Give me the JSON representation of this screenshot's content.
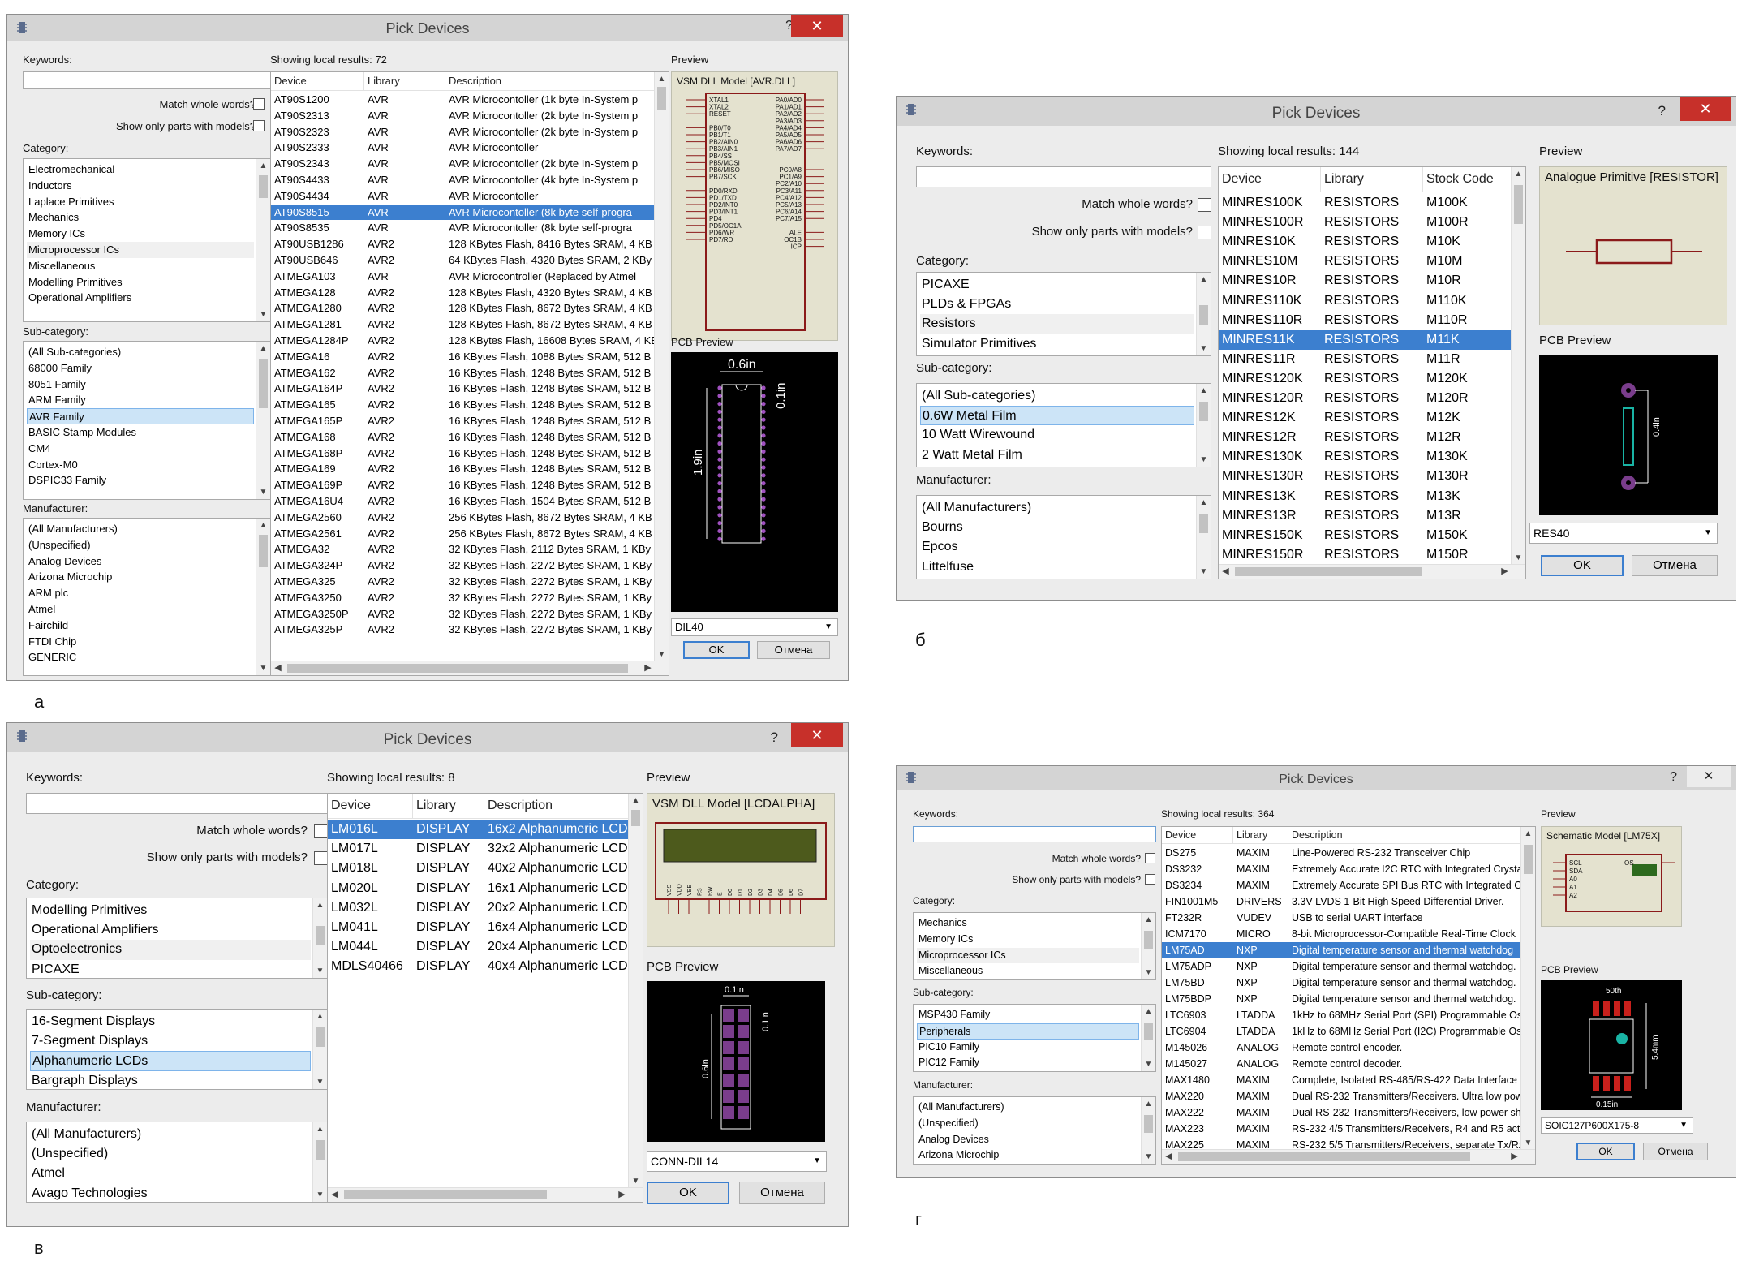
{
  "captions": [
    "а",
    "б",
    "в",
    "г"
  ],
  "common": {
    "title": "Pick Devices",
    "help": "?",
    "close": "✕",
    "keywords_label": "Keywords:",
    "match_whole": "Match whole words?",
    "show_only": "Show only parts with models?",
    "category_label": "Category:",
    "subcategory_label": "Sub-category:",
    "manufacturer_label": "Manufacturer:",
    "preview_label": "Preview",
    "pcb_preview_label": "PCB Preview",
    "ok": "OK",
    "cancel": "Отмена"
  },
  "dialog_a": {
    "results": "Showing local results: 72",
    "preview_title": "VSM DLL Model [AVR.DLL]",
    "footprint": "DIL40",
    "categories": [
      "Electromechanical",
      "Inductors",
      "Laplace Primitives",
      "Mechanics",
      "Memory ICs",
      "Microprocessor ICs",
      "Miscellaneous",
      "Modelling Primitives",
      "Operational Amplifiers"
    ],
    "subcategories": [
      "(All Sub-categories)",
      "68000 Family",
      "8051 Family",
      "ARM Family",
      "AVR Family",
      "BASIC Stamp Modules",
      "CM4",
      "Cortex-M0",
      "DSPIC33 Family"
    ],
    "manufacturers": [
      "(All Manufacturers)",
      "(Unspecified)",
      "Analog Devices",
      "Arizona Microchip",
      "ARM plc",
      "Atmel",
      "Fairchild",
      "FTDI Chip",
      "GENERIC"
    ],
    "columns": [
      "Device",
      "Library",
      "Description"
    ],
    "rows": [
      [
        "AT90S1200",
        "AVR",
        "AVR Microcontoller (1k byte In-System p"
      ],
      [
        "AT90S2313",
        "AVR",
        "AVR Microcontoller (2k byte In-System p"
      ],
      [
        "AT90S2323",
        "AVR",
        "AVR Microcontoller (2k byte In-System p"
      ],
      [
        "AT90S2333",
        "AVR",
        "AVR Microcontoller"
      ],
      [
        "AT90S2343",
        "AVR",
        "AVR Microcontoller (2k byte In-System p"
      ],
      [
        "AT90S4433",
        "AVR",
        "AVR Microcontoller (4k byte In-System p"
      ],
      [
        "AT90S4434",
        "AVR",
        "AVR Microcontoller"
      ],
      [
        "AT90S8515",
        "AVR",
        "AVR Microcontoller (8k byte self-progra"
      ],
      [
        "AT90S8535",
        "AVR",
        "AVR Microcontoller (8k byte self-progra"
      ],
      [
        "AT90USB1286",
        "AVR2",
        "128 KBytes Flash, 8416 Bytes SRAM, 4 KB"
      ],
      [
        "AT90USB646",
        "AVR2",
        "64 KBytes Flash, 4320 Bytes SRAM, 2 KBy"
      ],
      [
        "ATMEGA103",
        "AVR",
        "AVR Microcontroller (Replaced by Atmel"
      ],
      [
        "ATMEGA128",
        "AVR2",
        "128 KBytes Flash, 4320 Bytes SRAM, 4 KB"
      ],
      [
        "ATMEGA1280",
        "AVR2",
        "128 KBytes Flash, 8672 Bytes SRAM, 4 KB"
      ],
      [
        "ATMEGA1281",
        "AVR2",
        "128 KBytes Flash, 8672 Bytes SRAM, 4 KB"
      ],
      [
        "ATMEGA1284P",
        "AVR2",
        "128 KBytes Flash, 16608 Bytes SRAM, 4 KB"
      ],
      [
        "ATMEGA16",
        "AVR2",
        "16 KBytes Flash, 1088 Bytes SRAM, 512 B"
      ],
      [
        "ATMEGA162",
        "AVR2",
        "16 KBytes Flash, 1248 Bytes SRAM, 512 B"
      ],
      [
        "ATMEGA164P",
        "AVR2",
        "16 KBytes Flash, 1248 Bytes SRAM, 512 B"
      ],
      [
        "ATMEGA165",
        "AVR2",
        "16 KBytes Flash, 1248 Bytes SRAM, 512 B"
      ],
      [
        "ATMEGA165P",
        "AVR2",
        "16 KBytes Flash, 1248 Bytes SRAM, 512 B"
      ],
      [
        "ATMEGA168",
        "AVR2",
        "16 KBytes Flash, 1248 Bytes SRAM, 512 B"
      ],
      [
        "ATMEGA168P",
        "AVR2",
        "16 KBytes Flash, 1248 Bytes SRAM, 512 B"
      ],
      [
        "ATMEGA169",
        "AVR2",
        "16 KBytes Flash, 1248 Bytes SRAM, 512 B"
      ],
      [
        "ATMEGA169P",
        "AVR2",
        "16 KBytes Flash, 1248 Bytes SRAM, 512 B"
      ],
      [
        "ATMEGA16U4",
        "AVR2",
        "16 KBytes Flash, 1504 Bytes SRAM, 512 B"
      ],
      [
        "ATMEGA2560",
        "AVR2",
        "256 KBytes Flash, 8672 Bytes SRAM, 4 KB"
      ],
      [
        "ATMEGA2561",
        "AVR2",
        "256 KBytes Flash, 8672 Bytes SRAM, 4 KB"
      ],
      [
        "ATMEGA32",
        "AVR2",
        "32 KBytes Flash, 2112 Bytes SRAM, 1 KBy"
      ],
      [
        "ATMEGA324P",
        "AVR2",
        "32 KBytes Flash, 2272 Bytes SRAM, 1 KBy"
      ],
      [
        "ATMEGA325",
        "AVR2",
        "32 KBytes Flash, 2272 Bytes SRAM, 1 KBy"
      ],
      [
        "ATMEGA3250",
        "AVR2",
        "32 KBytes Flash, 2272 Bytes SRAM, 1 KBy"
      ],
      [
        "ATMEGA3250P",
        "AVR2",
        "32 KBytes Flash, 2272 Bytes SRAM, 1 KBy"
      ],
      [
        "ATMEGA325P",
        "AVR2",
        "32 KBytes Flash, 2272 Bytes SRAM, 1 KBy"
      ]
    ],
    "pin_left": [
      "XTAL1",
      "XTAL2",
      "RESET",
      "",
      "PB0/T0",
      "PB1/T1",
      "PB2/AIN0",
      "PB3/AIN1",
      "PB4/SS",
      "PB5/MOSI",
      "PB6/MISO",
      "PB7/SCK",
      "",
      "PD0/RXD",
      "PD1/TXD",
      "PD2/INT0",
      "PD3/INT1",
      "PD4",
      "PD5/OC1A",
      "PD6/WR",
      "PD7/RD"
    ],
    "pin_right": [
      "PA0/AD0",
      "PA1/AD1",
      "PA2/AD2",
      "PA3/AD3",
      "PA4/AD4",
      "PA5/AD5",
      "PA6/AD6",
      "PA7/AD7",
      "",
      "",
      "PC0/A8",
      "PC1/A9",
      "PC2/A10",
      "PC3/A11",
      "PC4/A12",
      "PC5/A13",
      "PC6/A14",
      "PC7/A15",
      "",
      "ALE",
      "OC1B",
      "ICP"
    ],
    "pcb_width": "0.6in",
    "pcb_pitch": "0.1in",
    "pcb_height": "1.9in"
  },
  "dialog_b": {
    "results": "Showing local results: 144",
    "preview_title": "Analogue Primitive [RESISTOR]",
    "footprint": "RES40",
    "categories": [
      "PICAXE",
      "PLDs & FPGAs",
      "Resistors",
      "Simulator Primitives"
    ],
    "subcategories": [
      "(All Sub-categories)",
      "0.6W Metal Film",
      "10 Watt Wirewound",
      "2 Watt Metal Film"
    ],
    "manufacturers": [
      "(All Manufacturers)",
      "Bourns",
      "Epcos",
      "Littelfuse"
    ],
    "columns": [
      "Device",
      "Library",
      "Stock Code"
    ],
    "rows": [
      [
        "MINRES100K",
        "RESISTORS",
        "M100K"
      ],
      [
        "MINRES100R",
        "RESISTORS",
        "M100R"
      ],
      [
        "MINRES10K",
        "RESISTORS",
        "M10K"
      ],
      [
        "MINRES10M",
        "RESISTORS",
        "M10M"
      ],
      [
        "MINRES10R",
        "RESISTORS",
        "M10R"
      ],
      [
        "MINRES110K",
        "RESISTORS",
        "M110K"
      ],
      [
        "MINRES110R",
        "RESISTORS",
        "M110R"
      ],
      [
        "MINRES11K",
        "RESISTORS",
        "M11K"
      ],
      [
        "MINRES11R",
        "RESISTORS",
        "M11R"
      ],
      [
        "MINRES120K",
        "RESISTORS",
        "M120K"
      ],
      [
        "MINRES120R",
        "RESISTORS",
        "M120R"
      ],
      [
        "MINRES12K",
        "RESISTORS",
        "M12K"
      ],
      [
        "MINRES12R",
        "RESISTORS",
        "M12R"
      ],
      [
        "MINRES130K",
        "RESISTORS",
        "M130K"
      ],
      [
        "MINRES130R",
        "RESISTORS",
        "M130R"
      ],
      [
        "MINRES13K",
        "RESISTORS",
        "M13K"
      ],
      [
        "MINRES13R",
        "RESISTORS",
        "M13R"
      ],
      [
        "MINRES150K",
        "RESISTORS",
        "M150K"
      ],
      [
        "MINRES150R",
        "RESISTORS",
        "M150R"
      ]
    ],
    "pcb_len": "0.4in"
  },
  "dialog_v": {
    "results": "Showing local results: 8",
    "preview_title": "VSM DLL Model [LCDALPHA]",
    "footprint": "CONN-DIL14",
    "categories": [
      "Modelling Primitives",
      "Operational Amplifiers",
      "Optoelectronics",
      "PICAXE"
    ],
    "subcategories": [
      "16-Segment Displays",
      "7-Segment Displays",
      "Alphanumeric LCDs",
      "Bargraph Displays"
    ],
    "manufacturers": [
      "(All Manufacturers)",
      "(Unspecified)",
      "Atmel",
      "Avago Technologies"
    ],
    "columns": [
      "Device",
      "Library",
      "Description"
    ],
    "rows": [
      [
        "LM016L",
        "DISPLAY",
        "16x2 Alphanumeric LCD"
      ],
      [
        "LM017L",
        "DISPLAY",
        "32x2 Alphanumeric LCD"
      ],
      [
        "LM018L",
        "DISPLAY",
        "40x2 Alphanumeric LCD"
      ],
      [
        "LM020L",
        "DISPLAY",
        "16x1 Alphanumeric LCD"
      ],
      [
        "LM032L",
        "DISPLAY",
        "20x2 Alphanumeric LCD"
      ],
      [
        "LM041L",
        "DISPLAY",
        "16x4 Alphanumeric LCD"
      ],
      [
        "LM044L",
        "DISPLAY",
        "20x4 Alphanumeric LCD"
      ],
      [
        "MDLS40466",
        "DISPLAY",
        "40x4 Alphanumeric LCD I"
      ]
    ],
    "lcd_pins": [
      "VSS",
      "VDD",
      "VEE",
      "RS",
      "RW",
      "E",
      "D0",
      "D1",
      "D2",
      "D3",
      "D4",
      "D5",
      "D6",
      "D7"
    ],
    "pcb_pitch_h": "0.1in",
    "pcb_pitch_v": "0.1in",
    "pcb_height": "0.6in"
  },
  "dialog_g": {
    "results": "Showing local results: 364",
    "preview_title": "Schematic Model [LM75X]",
    "footprint": "SOIC127P600X175-8",
    "categories": [
      "Mechanics",
      "Memory ICs",
      "Microprocessor ICs",
      "Miscellaneous"
    ],
    "subcategories": [
      "MSP430 Family",
      "Peripherals",
      "PIC10 Family",
      "PIC12 Family"
    ],
    "manufacturers": [
      "(All Manufacturers)",
      "(Unspecified)",
      "Analog Devices",
      "Arizona Microchip"
    ],
    "columns": [
      "Device",
      "Library",
      "Description"
    ],
    "rows": [
      [
        "DS275",
        "MAXIM",
        "Line-Powered RS-232 Transceiver Chip"
      ],
      [
        "DS3232",
        "MAXIM",
        "Extremely Accurate I2C RTC with Integrated Crysta"
      ],
      [
        "DS3234",
        "MAXIM",
        "Extremely Accurate SPI Bus RTC with Integrated Cr"
      ],
      [
        "FIN1001M5",
        "DRIVERS",
        "3.3V LVDS 1-Bit High Speed Differential Driver."
      ],
      [
        "FT232R",
        "VUDEV",
        "USB to serial UART interface"
      ],
      [
        "ICM7170",
        "MICRO",
        "8-bit Microprocessor-Compatible Real-Time Clock"
      ],
      [
        "LM75AD",
        "NXP",
        "Digital temperature sensor and thermal watchdog"
      ],
      [
        "LM75ADP",
        "NXP",
        "Digital temperature sensor and thermal watchdog."
      ],
      [
        "LM75BD",
        "NXP",
        "Digital temperature sensor and thermal watchdog."
      ],
      [
        "LM75BDP",
        "NXP",
        "Digital temperature sensor and thermal watchdog."
      ],
      [
        "LTC6903",
        "LTADDA",
        "1kHz to 68MHz Serial Port (SPI) Programmable Osc"
      ],
      [
        "LTC6904",
        "LTADDA",
        "1kHz to 68MHz Serial Port (I2C) Programmable Osc"
      ],
      [
        "M145026",
        "ANALOG",
        "Remote control encoder."
      ],
      [
        "M145027",
        "ANALOG",
        "Remote control decoder."
      ],
      [
        "MAX1480",
        "MAXIM",
        "Complete, Isolated RS-485/RS-422 Data Interface"
      ],
      [
        "MAX220",
        "MAXIM",
        "Dual RS-232 Transmitters/Receivers. Ultra low pow"
      ],
      [
        "MAX222",
        "MAXIM",
        "Dual RS-232 Transmitters/Receivers, low power shu"
      ],
      [
        "MAX223",
        "MAXIM",
        "RS-232 4/5 Transmitters/Receivers, R4 and R5 activ"
      ],
      [
        "MAX225",
        "MAXIM",
        "RS-232 5/5 Transmitters/Receivers, separate Tx/Rx"
      ]
    ],
    "chip_pins": [
      "SCL",
      "SDA",
      "A0",
      "A1",
      "A2",
      "OS"
    ],
    "pcb_pitch": "50th",
    "pcb_height": "5.4mm",
    "pcb_width": "0.15in"
  }
}
